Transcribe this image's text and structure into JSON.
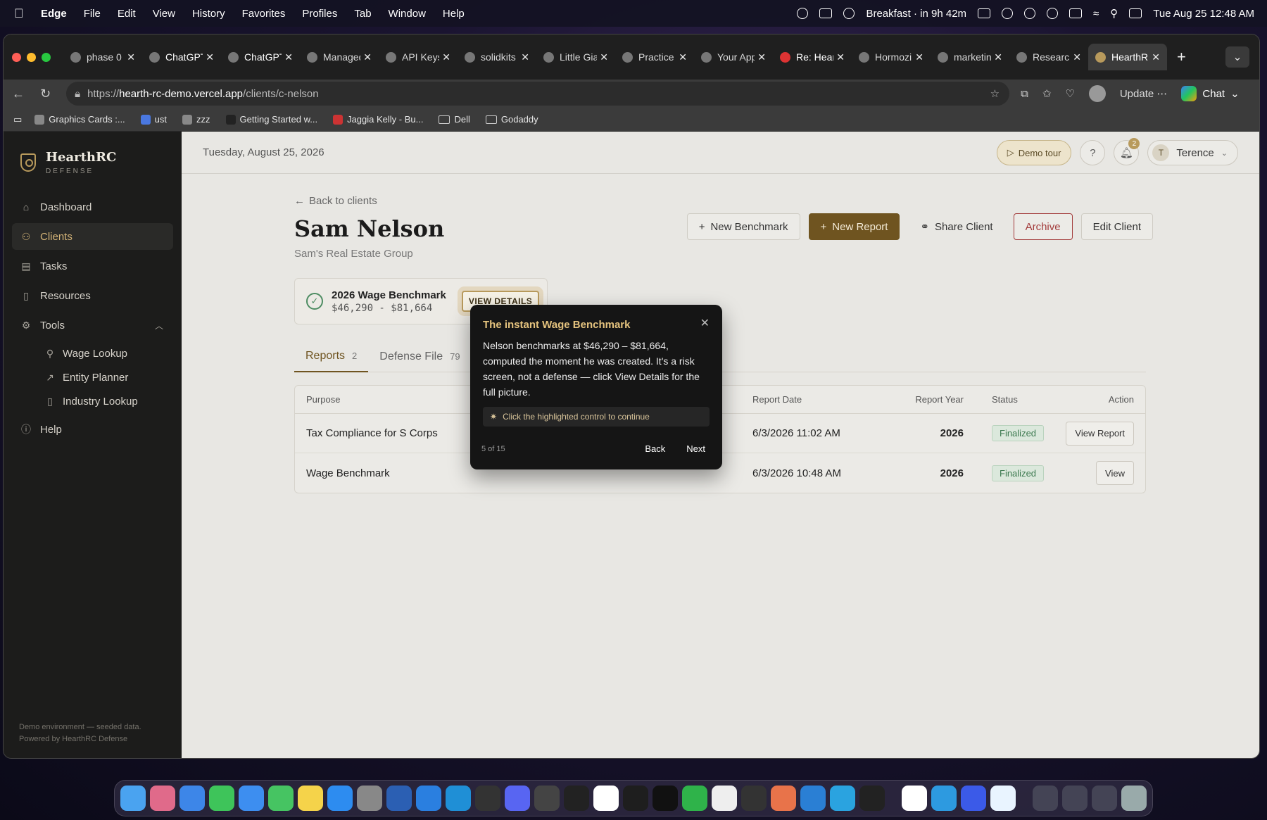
{
  "menubar": {
    "app": "Edge",
    "items": [
      "File",
      "Edit",
      "View",
      "History",
      "Favorites",
      "Profiles",
      "Tab",
      "Window",
      "Help"
    ],
    "event": "Breakfast · in 9h 42m",
    "datetime": "Tue Aug 25  12:48 AM"
  },
  "browser": {
    "tabs": [
      {
        "title": "phase 0",
        "active": false
      },
      {
        "title": "ChatGPT",
        "active": false
      },
      {
        "title": "ChatGPT",
        "active": false
      },
      {
        "title": "Managed",
        "active": false
      },
      {
        "title": "API Keys",
        "active": false
      },
      {
        "title": "solidkits",
        "active": false
      },
      {
        "title": "Little Gia",
        "active": false
      },
      {
        "title": "Practice",
        "active": false
      },
      {
        "title": "Your App",
        "active": false
      },
      {
        "title": "Re: Hear",
        "active": false
      },
      {
        "title": "Hormozi",
        "active": false
      },
      {
        "title": "marketin",
        "active": false
      },
      {
        "title": "Research",
        "active": false
      },
      {
        "title": "HearthR",
        "active": true
      }
    ],
    "url_prefix": "https://",
    "url_host": "hearth-rc-demo.vercel.app",
    "url_path": "/clients/c-nelson",
    "update_label": "Update",
    "chat_label": "Chat",
    "bookmarks": [
      "Graphics Cards :...",
      "ust",
      "zzz",
      "Getting Started w...",
      "Jaggia Kelly - Bu...",
      "Dell",
      "Godaddy"
    ]
  },
  "sidebar": {
    "brand": "HearthRC",
    "brand_sub": "DEFENSE",
    "items": [
      {
        "label": "Dashboard",
        "icon": "home-icon"
      },
      {
        "label": "Clients",
        "icon": "users-icon",
        "active": true
      },
      {
        "label": "Tasks",
        "icon": "clipboard-icon"
      },
      {
        "label": "Resources",
        "icon": "book-icon"
      },
      {
        "label": "Tools",
        "icon": "gear-icon"
      }
    ],
    "tools": [
      {
        "label": "Wage Lookup",
        "icon": "search-icon"
      },
      {
        "label": "Entity Planner",
        "icon": "trend-icon"
      },
      {
        "label": "Industry Lookup",
        "icon": "book-icon"
      }
    ],
    "help": "Help",
    "footer1": "Demo environment — seeded data.",
    "footer2": "Powered by HearthRC Defense"
  },
  "topbar": {
    "date": "Tuesday, August 25, 2026",
    "demo_tour": "Demo tour",
    "help": "?",
    "notif_count": "2",
    "user_initial": "T",
    "user_name": "Terence"
  },
  "client": {
    "back": "Back to clients",
    "name": "Sam Nelson",
    "company": "Sam's Real Estate Group",
    "actions": {
      "new_benchmark": "New Benchmark",
      "new_report": "New Report",
      "share": "Share Client",
      "archive": "Archive",
      "edit": "Edit Client"
    },
    "benchmark": {
      "title": "2026 Wage Benchmark",
      "range": "$46,290 - $81,664",
      "view_details": "VIEW DETAILS"
    },
    "tabs": [
      {
        "label": "Reports",
        "count": "2",
        "active": true
      },
      {
        "label": "Defense File",
        "count": "79"
      }
    ]
  },
  "table": {
    "headers": {
      "purpose": "Purpose",
      "report_date": "Report Date",
      "report_year": "Report Year",
      "status": "Status",
      "action": "Action"
    },
    "rows": [
      {
        "purpose": "Tax Compliance for S Corps",
        "date": "6/3/2026 11:02 AM",
        "year": "2026",
        "status": "Finalized",
        "action": "View Report"
      },
      {
        "purpose": "Wage Benchmark",
        "date": "6/3/2026 10:48 AM",
        "year": "2026",
        "status": "Finalized",
        "action": "View"
      }
    ]
  },
  "popover": {
    "title": "The instant Wage Benchmark",
    "body": "Nelson benchmarks at $46,290 – $81,664, computed the moment he was created. It's a risk screen, not a defense — click View Details for the full picture.",
    "hint": "Click the highlighted control to continue",
    "step": "5 of 15",
    "back": "Back",
    "next": "Next"
  },
  "colors": {
    "accent": "#6f5420",
    "gold": "#d4b478",
    "danger": "#a33b3b",
    "success": "#3d7a50"
  }
}
